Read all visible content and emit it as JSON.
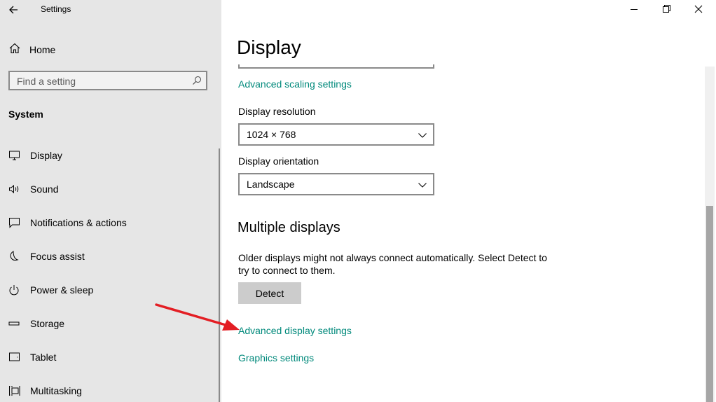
{
  "window": {
    "title": "Settings",
    "controls": {
      "minimize": "minimize",
      "restore": "restore",
      "close": "close"
    }
  },
  "sidebar": {
    "home_label": "Home",
    "search_placeholder": "Find a setting",
    "section_label": "System",
    "items": [
      {
        "label": "Display",
        "icon": "monitor-icon"
      },
      {
        "label": "Sound",
        "icon": "speaker-icon"
      },
      {
        "label": "Notifications & actions",
        "icon": "message-icon"
      },
      {
        "label": "Focus assist",
        "icon": "moon-icon"
      },
      {
        "label": "Power & sleep",
        "icon": "power-icon"
      },
      {
        "label": "Storage",
        "icon": "storage-icon"
      },
      {
        "label": "Tablet",
        "icon": "tablet-icon"
      },
      {
        "label": "Multitasking",
        "icon": "multitasking-icon"
      }
    ]
  },
  "main": {
    "title": "Display",
    "advanced_scaling_link": "Advanced scaling settings",
    "resolution_label": "Display resolution",
    "resolution_value": "1024 × 768",
    "orientation_label": "Display orientation",
    "orientation_value": "Landscape",
    "multiple_displays_heading": "Multiple displays",
    "multiple_displays_desc": "Older displays might not always connect automatically. Select Detect to try to connect to them.",
    "detect_button": "Detect",
    "advanced_display_link": "Advanced display settings",
    "graphics_link": "Graphics settings"
  },
  "colors": {
    "accent_link": "#00897b",
    "annotation_arrow": "#e31e24",
    "sidebar_bg": "#e6e6e6"
  }
}
